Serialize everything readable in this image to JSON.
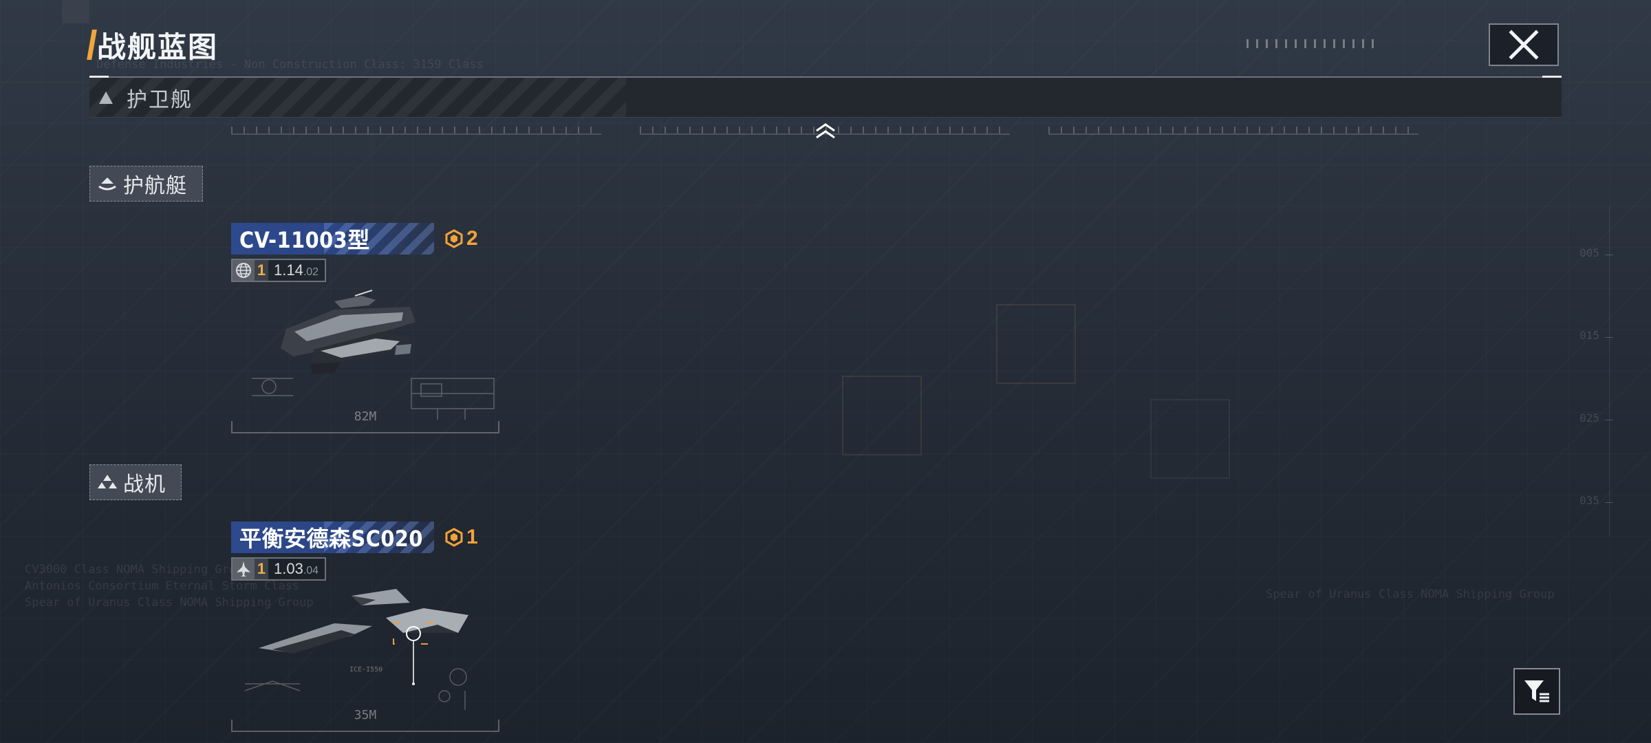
{
  "header": {
    "title": "战舰蓝图"
  },
  "category": {
    "label": "护卫舰"
  },
  "sections": [
    {
      "label": "护航艇",
      "ship": {
        "name": "CV-11003型",
        "count": "2",
        "tier": "1",
        "version_main": "1.14",
        "version_sub": ".02",
        "length": "82M"
      }
    },
    {
      "label": "战机",
      "ship": {
        "name": "平衡安德森SC020",
        "count": "1",
        "tier": "1",
        "version_main": "1.03",
        "version_sub": ".04",
        "length": "35M"
      }
    }
  ],
  "background_text": {
    "top_ghost": "Defense Industries - Non Construction Class: 3159 Class",
    "left_ghost_1": "CV3000 Class NOMA Shipping Group ...",
    "left_ghost_2": "Antonios Consortium Eternal Storm Class",
    "left_ghost_3": "Spear of Uranus Class NOMA Shipping Group",
    "right_ghost": "Spear of Uranus Class NOMA Shipping Group",
    "scale_005": "005",
    "scale_015": "015",
    "scale_025": "025",
    "scale_035": "035"
  },
  "colors": {
    "accent_orange": "#f2a33a",
    "ribbon_blue": "#2e4a8e",
    "background": "#262d38"
  },
  "icons": {
    "close": "close-icon",
    "category": "triangle-up-icon",
    "collapse": "chevron-up-icon",
    "escort_boat": "escort-boat-icon",
    "fighter": "fighter-icon",
    "count_badge": "blueprint-badge-icon",
    "globe": "globe-icon",
    "jet": "jet-icon",
    "filter": "filter-icon"
  }
}
